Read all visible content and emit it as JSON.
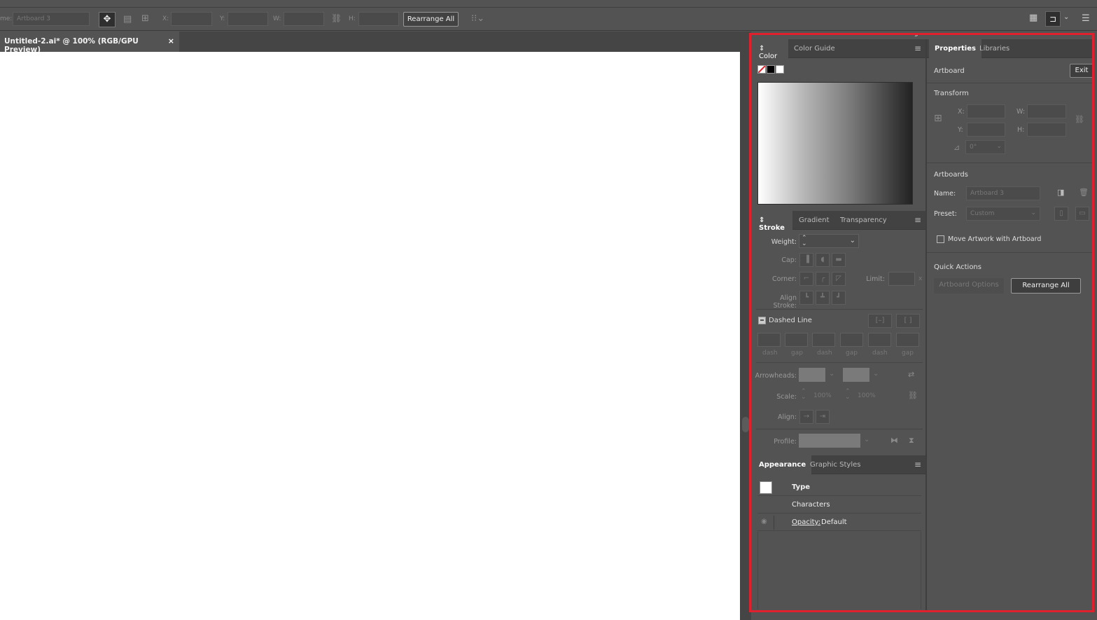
{
  "control_bar": {
    "name_label": "me:",
    "artboard_name": "Artboard 3",
    "x_label": "X:",
    "y_label": "Y:",
    "w_label": "W:",
    "h_label": "H:",
    "rearrange_label": "Rearrange All"
  },
  "document": {
    "tab_title": "Untitled-2.ai* @ 100% (RGB/GPU Preview)",
    "close_glyph": "×"
  },
  "color_panel": {
    "tabs": [
      "Color",
      "Color Guide"
    ],
    "active_tab": "Color",
    "menu_glyph": "≡"
  },
  "stroke_panel": {
    "tabs": [
      "Stroke",
      "Gradient",
      "Transparency"
    ],
    "weight_label": "Weight:",
    "cap_label": "Cap:",
    "corner_label": "Corner:",
    "limit_label": "Limit:",
    "limit_suffix": "x",
    "align_stroke_label": "Align Stroke:",
    "dashed_line_label": "Dashed Line",
    "dash_labels": [
      "dash",
      "gap",
      "dash",
      "gap",
      "dash",
      "gap"
    ],
    "arrowheads_label": "Arrowheads:",
    "scale_label": "Scale:",
    "scale_value_1": "100%",
    "scale_value_2": "100%",
    "align_label": "Align:",
    "profile_label": "Profile:"
  },
  "appearance_panel": {
    "tabs": [
      "Appearance",
      "Graphic Styles"
    ],
    "rows": {
      "type": "Type",
      "characters": "Characters",
      "opacity_label": "Opacity:",
      "opacity_value": "Default"
    }
  },
  "properties_panel": {
    "tabs": [
      "Properties",
      "Libraries"
    ],
    "artboard_label": "Artboard",
    "exit_label": "Exit",
    "transform_title": "Transform",
    "x_label": "X:",
    "y_label": "Y:",
    "w_label": "W:",
    "h_label": "H:",
    "angle_value": "0°",
    "artboards_title": "Artboards",
    "name_label": "Name:",
    "name_value": "Artboard 3",
    "preset_label": "Preset:",
    "preset_value": "Custom",
    "move_artwork_label": "Move Artwork with Artboard",
    "quick_actions_title": "Quick Actions",
    "artboard_options_label": "Artboard Options",
    "rearrange_all_label": "Rearrange All"
  },
  "colors": {
    "highlight": "#e0202c",
    "panel_bg": "#535353",
    "canvas": "#ffffff"
  }
}
